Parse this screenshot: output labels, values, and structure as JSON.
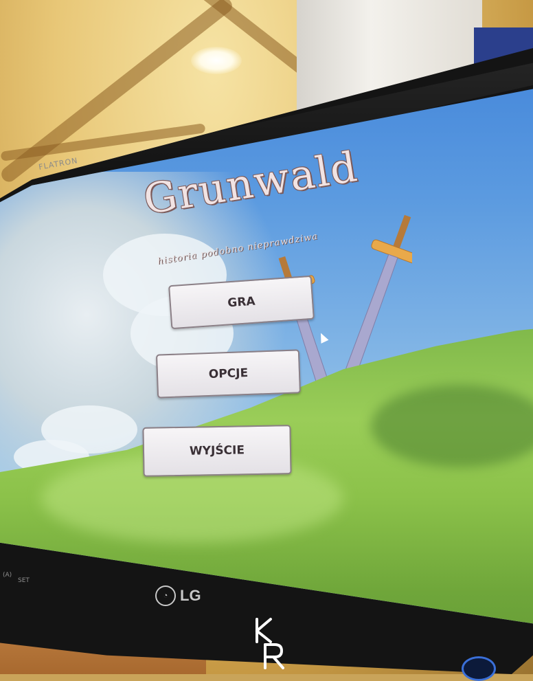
{
  "game": {
    "title": "Grunwald",
    "subtitle": "historia podobno nieprawdziwa",
    "menu": {
      "play": "GRA",
      "options": "OPCJE",
      "exit": "WYJŚCIE"
    }
  },
  "monitor": {
    "model_label": "FLATRON",
    "brand": "LG",
    "button_labels": [
      "(A)",
      "SET"
    ]
  },
  "watermark": "KR",
  "colors": {
    "button_bg": "#f3f1f4",
    "button_border": "#8b7f86",
    "sky": "#5c9be0",
    "grass": "#8cc24a",
    "sword_blade": "#a9a8cf",
    "sword_guard": "#e9a94a"
  }
}
